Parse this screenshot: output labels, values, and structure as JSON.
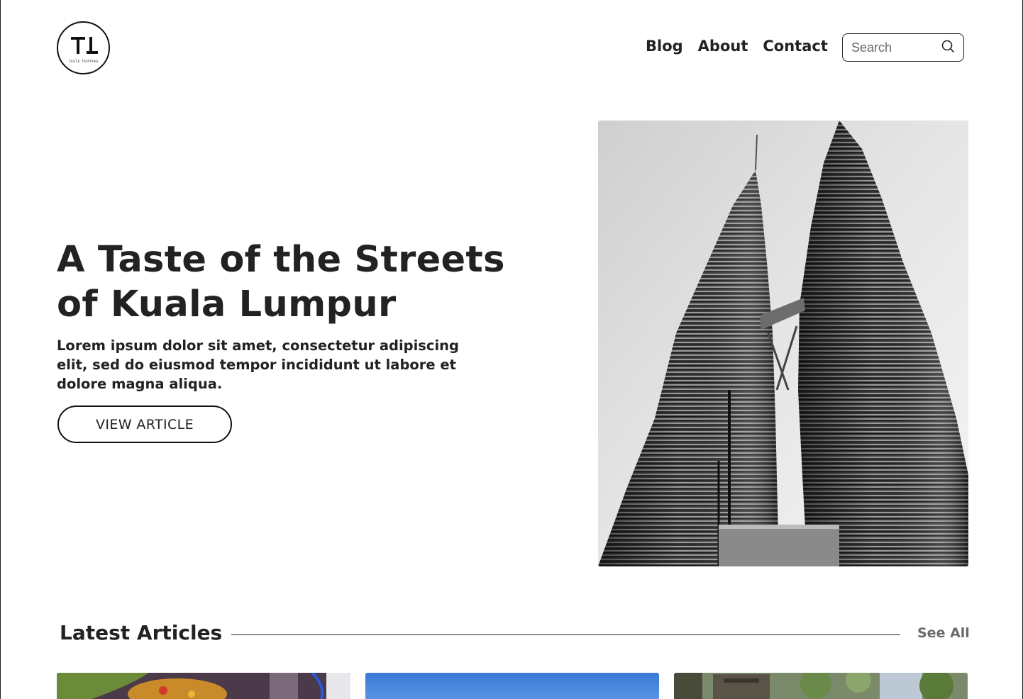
{
  "logo": {
    "letters": "TL",
    "tagline": "TASTE TRIPPING"
  },
  "nav": {
    "items": [
      "Blog",
      "About",
      "Contact"
    ]
  },
  "search": {
    "placeholder": "Search"
  },
  "hero": {
    "title": "A Taste of the Streets of Kuala Lumpur",
    "body": "Lorem ipsum dolor sit amet, consectetur adipiscing elit, sed do eiusmod tempor incididunt ut labore et dolore magna aliqua.",
    "button_label": "VIEW ARTICLE",
    "image_alt": "Petronas Twin Towers black and white photo"
  },
  "latest": {
    "title": "Latest Articles",
    "see_all": "See All"
  }
}
